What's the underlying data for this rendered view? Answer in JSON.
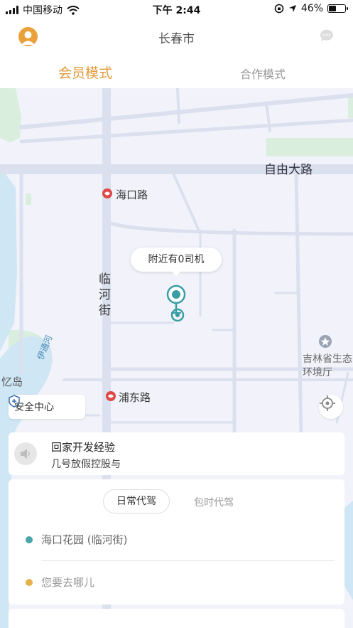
{
  "status_bar": {
    "carrier": "中国移动",
    "time": "下午 2:44",
    "battery": "46%"
  },
  "header": {
    "city": "长春市"
  },
  "mode_tabs": {
    "active": "会员模式",
    "inactive": "合作模式"
  },
  "map": {
    "labels": {
      "road_ziyou": "自由大路",
      "station_haikou": "海口路",
      "street_linhe": "临河街",
      "river_yitong": "伊通河",
      "island": "忆岛",
      "station_pudong": "浦东路",
      "poi_env": "吉林省生态环境厅"
    },
    "bubble": "附近有0司机",
    "safety_center": "安全中心"
  },
  "notice": {
    "title": "回家开发经验",
    "subtitle": "几号放假控股与"
  },
  "order": {
    "service_tabs": {
      "active": "日常代驾",
      "inactive": "包时代驾"
    },
    "from": "海口花园 (临河街)",
    "to": "您要去哪儿"
  },
  "colors": {
    "accent": "#e39a3b",
    "teal": "#3a9ea5",
    "origin_dot": "#4aa6ab",
    "dest_dot": "#e6b04a",
    "station_red": "#e04848"
  }
}
